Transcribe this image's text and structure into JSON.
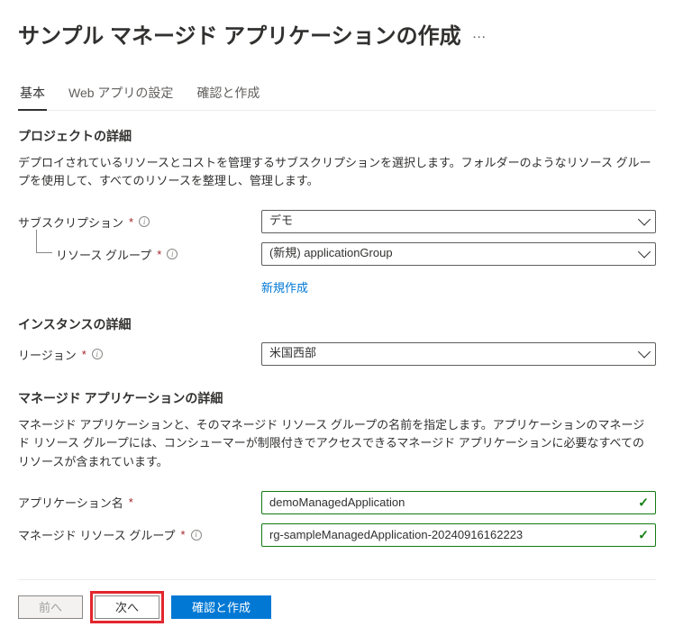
{
  "header": {
    "title": "サンプル マネージド アプリケーションの作成",
    "more_label": "…"
  },
  "tabs": {
    "basic": "基本",
    "webapp": "Web アプリの設定",
    "review": "確認と作成"
  },
  "sections": {
    "project": {
      "title": "プロジェクトの詳細",
      "desc": "デプロイされているリソースとコストを管理するサブスクリプションを選択します。フォルダーのようなリソース グループを使用して、すべてのリソースを整理し、管理します。"
    },
    "instance": {
      "title": "インスタンスの詳細"
    },
    "managed": {
      "title": "マネージド アプリケーションの詳細",
      "desc": "マネージド アプリケーションと、そのマネージド リソース グループの名前を指定します。アプリケーションのマネージド リソース グループには、コンシューマーが制限付きでアクセスできるマネージド アプリケーションに必要なすべてのリソースが含まれています。"
    }
  },
  "fields": {
    "subscription": {
      "label": "サブスクリプション",
      "value": "デモ"
    },
    "resource_group": {
      "label": "リソース グループ",
      "value": "(新規) applicationGroup",
      "create_new": "新規作成"
    },
    "region": {
      "label": "リージョン",
      "value": "米国西部"
    },
    "app_name": {
      "label": "アプリケーション名",
      "value": "demoManagedApplication"
    },
    "mrg": {
      "label": "マネージド リソース グループ",
      "value": "rg-sampleManagedApplication-20240916162223"
    }
  },
  "footer": {
    "prev": "前へ",
    "next": "次へ",
    "review_create": "確認と作成"
  }
}
